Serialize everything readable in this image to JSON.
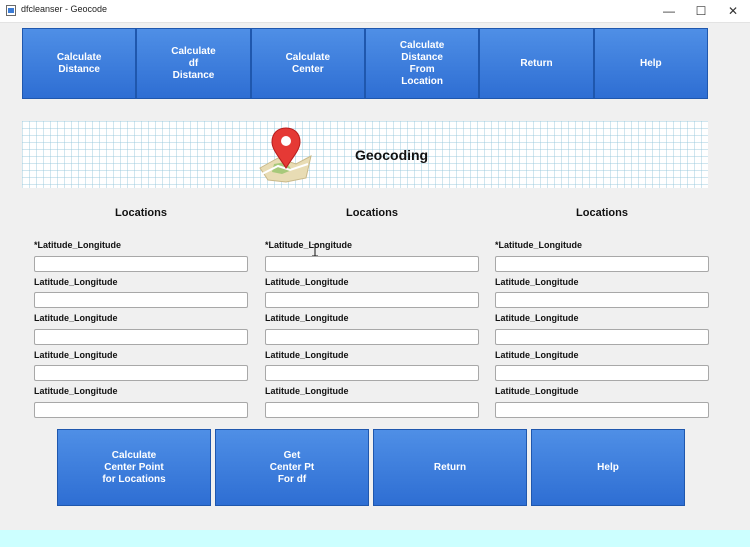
{
  "window": {
    "title": "dfcleanser - Geocode",
    "minimize_glyph": "—",
    "maximize_glyph": "☐",
    "close_glyph": "✕"
  },
  "toolbar": {
    "buttons": [
      {
        "label": "Calculate\nDistance"
      },
      {
        "label": "Calculate\ndf\nDistance"
      },
      {
        "label": "Calculate\nCenter"
      },
      {
        "label": "Calculate\nDistance\nFrom\nLocation"
      },
      {
        "label": "Return"
      },
      {
        "label": "Help"
      }
    ]
  },
  "banner": {
    "title": "Geocoding",
    "icon": "map-pin-icon"
  },
  "columns": [
    {
      "heading": "Locations",
      "fields": [
        {
          "label": "*Latitude_Longitude",
          "value": ""
        },
        {
          "label": "Latitude_Longitude",
          "value": ""
        },
        {
          "label": "Latitude_Longitude",
          "value": ""
        },
        {
          "label": "Latitude_Longitude",
          "value": ""
        },
        {
          "label": "Latitude_Longitude",
          "value": ""
        }
      ]
    },
    {
      "heading": "Locations",
      "fields": [
        {
          "label": "*Latitude_Longitude",
          "value": ""
        },
        {
          "label": "Latitude_Longitude",
          "value": ""
        },
        {
          "label": "Latitude_Longitude",
          "value": ""
        },
        {
          "label": "Latitude_Longitude",
          "value": ""
        },
        {
          "label": "Latitude_Longitude",
          "value": ""
        }
      ]
    },
    {
      "heading": "Locations",
      "fields": [
        {
          "label": "*Latitude_Longitude",
          "value": ""
        },
        {
          "label": "Latitude_Longitude",
          "value": ""
        },
        {
          "label": "Latitude_Longitude",
          "value": ""
        },
        {
          "label": "Latitude_Longitude",
          "value": ""
        },
        {
          "label": "Latitude_Longitude",
          "value": ""
        }
      ]
    }
  ],
  "actions": {
    "buttons": [
      {
        "label": "Calculate\nCenter Point\nfor Locations"
      },
      {
        "label": "Get\nCenter Pt\nFor df"
      },
      {
        "label": "Return"
      },
      {
        "label": "Help"
      }
    ]
  },
  "colors": {
    "button_top": "#4f8fe6",
    "button_bottom": "#2e6ed3",
    "status_strip": "#ccffff",
    "background": "#f0f0f0"
  }
}
